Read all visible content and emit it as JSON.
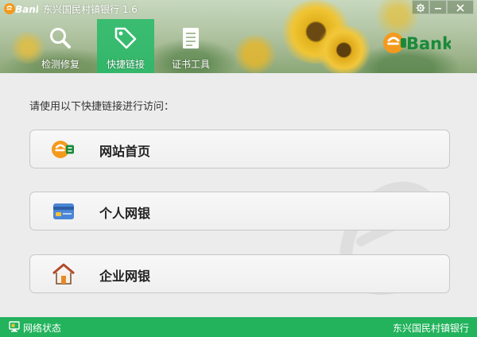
{
  "window": {
    "title": "东兴国民村镇银行 1.6",
    "logo_text": "Bank",
    "controls": [
      "settings-icon",
      "minimize-icon",
      "close-icon"
    ]
  },
  "nav": {
    "active_tab": "快捷链接",
    "tabs": [
      {
        "label": "检测修复",
        "icon": "search-icon"
      },
      {
        "label": "快捷链接",
        "icon": "tag-icon"
      },
      {
        "label": "证书工具",
        "icon": "document-icon"
      }
    ]
  },
  "brand": {
    "logo_text": "Bank"
  },
  "main": {
    "instruction": "请使用以下快捷链接进行访问：",
    "links": [
      {
        "label": "网站首页",
        "icon": "ebank-icon"
      },
      {
        "label": "个人网银",
        "icon": "bank-card-icon"
      },
      {
        "label": "企业网银",
        "icon": "house-icon"
      }
    ]
  },
  "status": {
    "network_label": "网络状态",
    "bank_name": "东兴国民村镇银行"
  },
  "colors": {
    "accent_green": "#22b35c",
    "logo_orange": "#f39a1e",
    "logo_green": "#1a8a3a"
  }
}
